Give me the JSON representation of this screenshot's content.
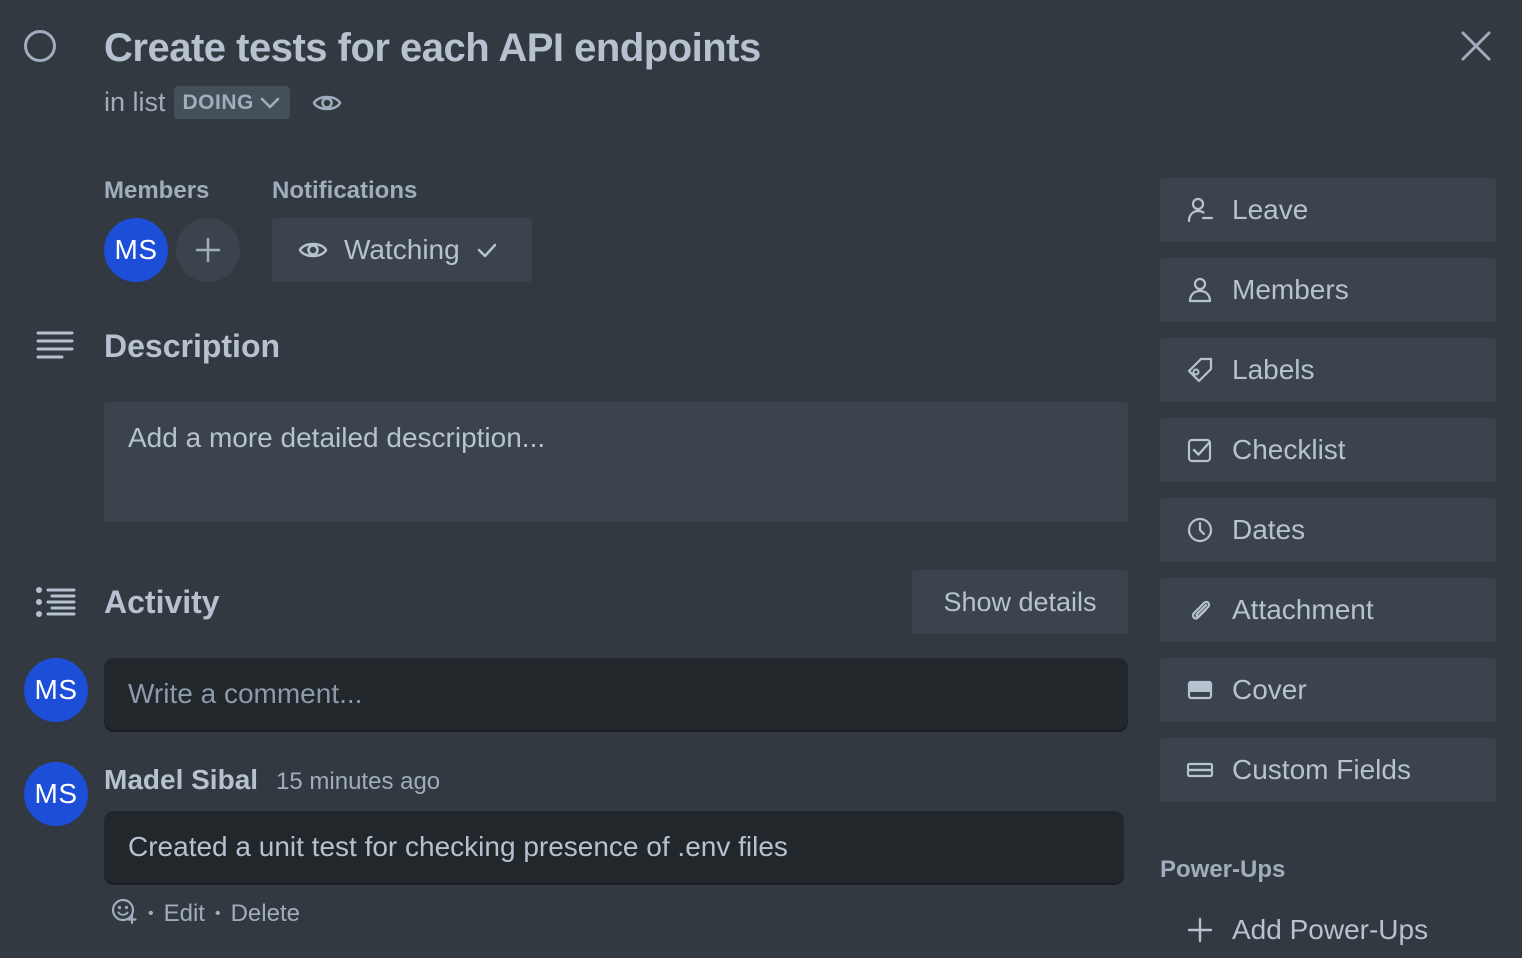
{
  "card": {
    "title": "Create tests for each API endpoints",
    "in_list_prefix": "in list",
    "list_name": "DOING"
  },
  "members": {
    "label": "Members",
    "avatars": [
      {
        "initials": "MS",
        "color": "#1d4ed8"
      }
    ]
  },
  "notifications": {
    "label": "Notifications",
    "button_label": "Watching"
  },
  "description": {
    "heading": "Description",
    "placeholder": "Add a more detailed description..."
  },
  "activity": {
    "heading": "Activity",
    "show_details_label": "Show details",
    "current_user_initials": "MS",
    "comment_placeholder": "Write a comment...",
    "comments": [
      {
        "author": "Madel Sibal",
        "initials": "MS",
        "time": "15 minutes ago",
        "text": "Created a unit test for checking presence of .env files",
        "actions": {
          "edit": "Edit",
          "delete": "Delete"
        }
      }
    ]
  },
  "sidebar": {
    "buttons": [
      {
        "label": "Leave",
        "icon": "leave-icon"
      },
      {
        "label": "Members",
        "icon": "person-icon"
      },
      {
        "label": "Labels",
        "icon": "label-tag-icon"
      },
      {
        "label": "Checklist",
        "icon": "checklist-icon"
      },
      {
        "label": "Dates",
        "icon": "clock-icon"
      },
      {
        "label": "Attachment",
        "icon": "paperclip-icon"
      },
      {
        "label": "Cover",
        "icon": "cover-icon"
      },
      {
        "label": "Custom Fields",
        "icon": "custom-fields-icon"
      }
    ],
    "powerups_label": "Power-Ups",
    "add_powerups_label": "Add Power-Ups"
  },
  "colors": {
    "background": "#323940",
    "button_bg": "#3b444d",
    "input_bg": "#22272b",
    "text": "#b6c2cf",
    "muted_text": "#9fadbc",
    "avatar": "#1d4ed8"
  }
}
